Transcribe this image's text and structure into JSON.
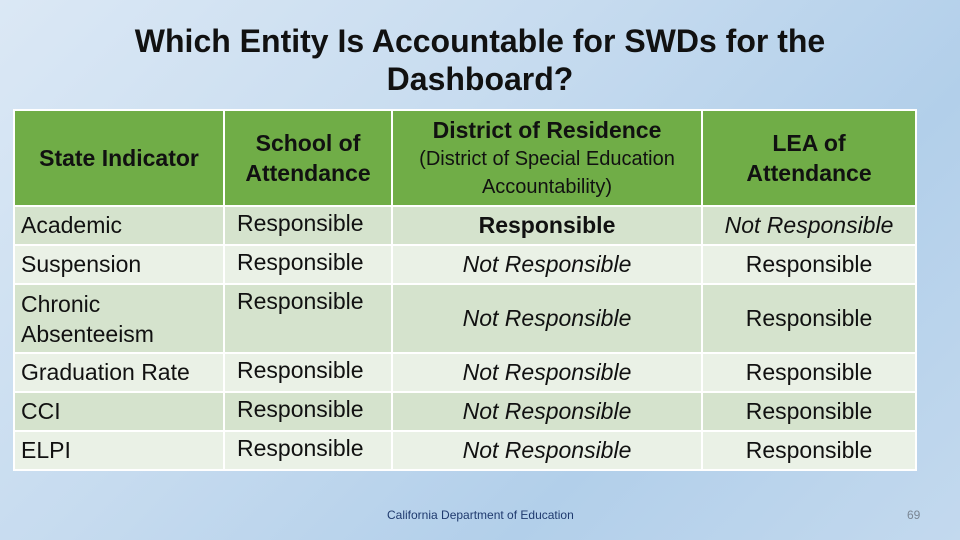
{
  "title": "Which Entity Is Accountable for SWDs for the Dashboard?",
  "table": {
    "headers": [
      {
        "main": "State Indicator",
        "sub": ""
      },
      {
        "main": "School of Attendance",
        "sub": ""
      },
      {
        "main": "District of Residence",
        "sub": "(District of Special Education Accountability)"
      },
      {
        "main": "LEA of Attendance",
        "sub": ""
      }
    ],
    "rows": [
      {
        "indicator": "Academic",
        "school": "Responsible",
        "district": "Responsible",
        "lea": "Not Responsible"
      },
      {
        "indicator": "Suspension",
        "school": "Responsible",
        "district": "Not Responsible",
        "lea": "Responsible"
      },
      {
        "indicator": "Chronic Absenteeism",
        "school": "Responsible",
        "district": "Not Responsible",
        "lea": "Responsible"
      },
      {
        "indicator": "Graduation Rate",
        "school": "Responsible",
        "district": "Not Responsible",
        "lea": "Responsible"
      },
      {
        "indicator": "CCI",
        "school": "Responsible",
        "district": "Not Responsible",
        "lea": "Responsible"
      },
      {
        "indicator": "ELPI",
        "school": "Responsible",
        "district": "Not Responsible",
        "lea": "Responsible"
      }
    ]
  },
  "footer": "California Department of Education",
  "page_number": "69",
  "colors": {
    "header_bg": "#70ad47",
    "row_dark": "#d5e3cd",
    "row_light": "#eaf1e6"
  }
}
